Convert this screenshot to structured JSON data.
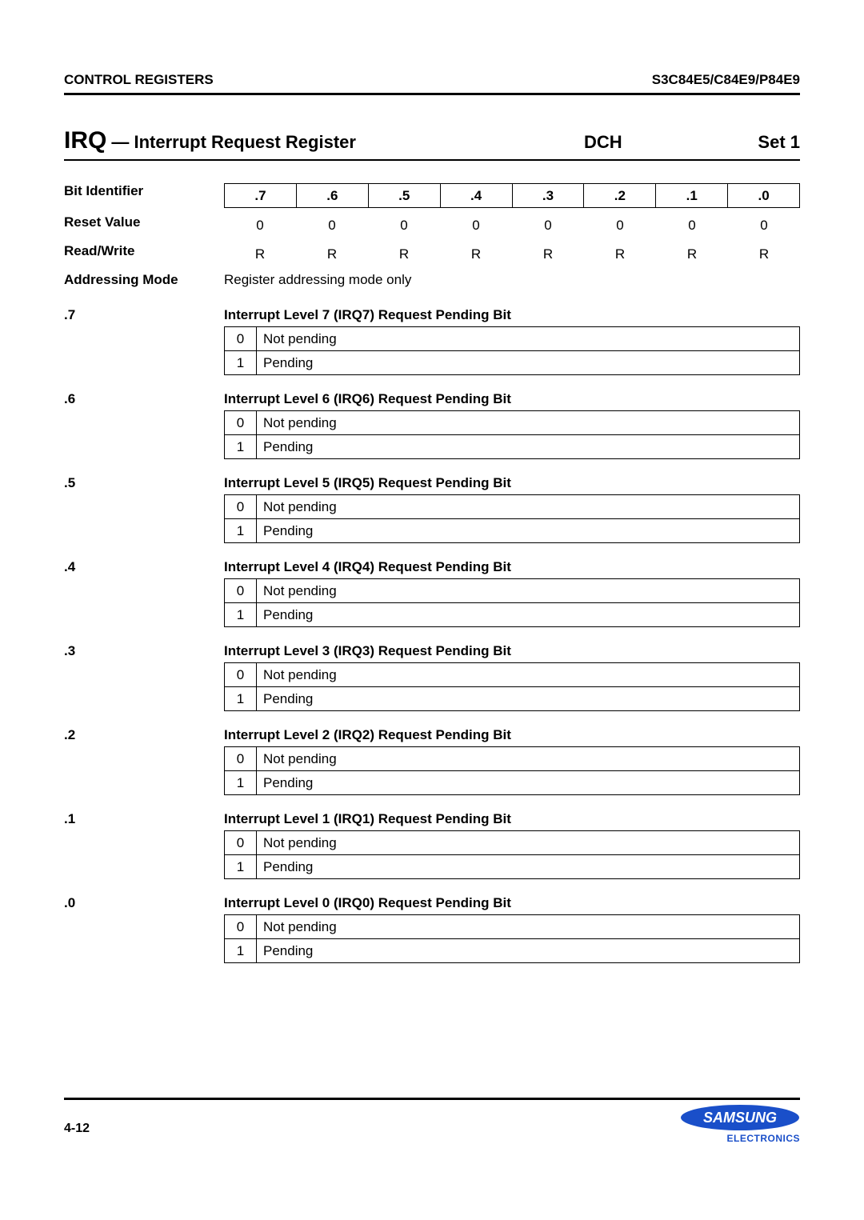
{
  "header": {
    "left": "CONTROL REGISTERS",
    "right": "S3C84E5/C84E9/P84E9"
  },
  "title": {
    "main": "IRQ",
    "sub": "— Interrupt Request Register",
    "code": "DCH",
    "set": "Set 1"
  },
  "info": {
    "bit_id_label": "Bit Identifier",
    "bits": [
      ".7",
      ".6",
      ".5",
      ".4",
      ".3",
      ".2",
      ".1",
      ".0"
    ],
    "reset_label": "Reset Value",
    "reset": [
      "0",
      "0",
      "0",
      "0",
      "0",
      "0",
      "0",
      "0"
    ],
    "rw_label": "Read/Write",
    "rw": [
      "R",
      "R",
      "R",
      "R",
      "R",
      "R",
      "R",
      "R"
    ],
    "addr_label": "Addressing Mode",
    "addr_value": "Register addressing mode only"
  },
  "sections": [
    {
      "key": ".7",
      "heading": "Interrupt Level 7 (IRQ7) Request Pending Bit",
      "rows": [
        [
          "0",
          "Not pending"
        ],
        [
          "1",
          "Pending"
        ]
      ]
    },
    {
      "key": ".6",
      "heading": "Interrupt Level 6 (IRQ6) Request Pending Bit",
      "rows": [
        [
          "0",
          "Not pending"
        ],
        [
          "1",
          "Pending"
        ]
      ]
    },
    {
      "key": ".5",
      "heading": "Interrupt Level 5 (IRQ5) Request Pending Bit",
      "rows": [
        [
          "0",
          "Not pending"
        ],
        [
          "1",
          "Pending"
        ]
      ]
    },
    {
      "key": ".4",
      "heading": "Interrupt Level 4 (IRQ4) Request Pending Bit",
      "rows": [
        [
          "0",
          "Not pending"
        ],
        [
          "1",
          "Pending"
        ]
      ]
    },
    {
      "key": ".3",
      "heading": "Interrupt Level 3 (IRQ3) Request Pending Bit",
      "rows": [
        [
          "0",
          "Not pending"
        ],
        [
          "1",
          "Pending"
        ]
      ]
    },
    {
      "key": ".2",
      "heading": "Interrupt Level 2 (IRQ2) Request Pending Bit",
      "rows": [
        [
          "0",
          "Not pending"
        ],
        [
          "1",
          "Pending"
        ]
      ]
    },
    {
      "key": ".1",
      "heading": "Interrupt Level 1 (IRQ1) Request Pending Bit",
      "rows": [
        [
          "0",
          "Not pending"
        ],
        [
          "1",
          "Pending"
        ]
      ]
    },
    {
      "key": ".0",
      "heading": "Interrupt Level 0 (IRQ0) Request Pending Bit",
      "rows": [
        [
          "0",
          "Not pending"
        ],
        [
          "1",
          "Pending"
        ]
      ]
    }
  ],
  "footer": {
    "page": "4-12",
    "logo_text": "SAMSUNG",
    "sub_text": "ELECTRONICS"
  }
}
